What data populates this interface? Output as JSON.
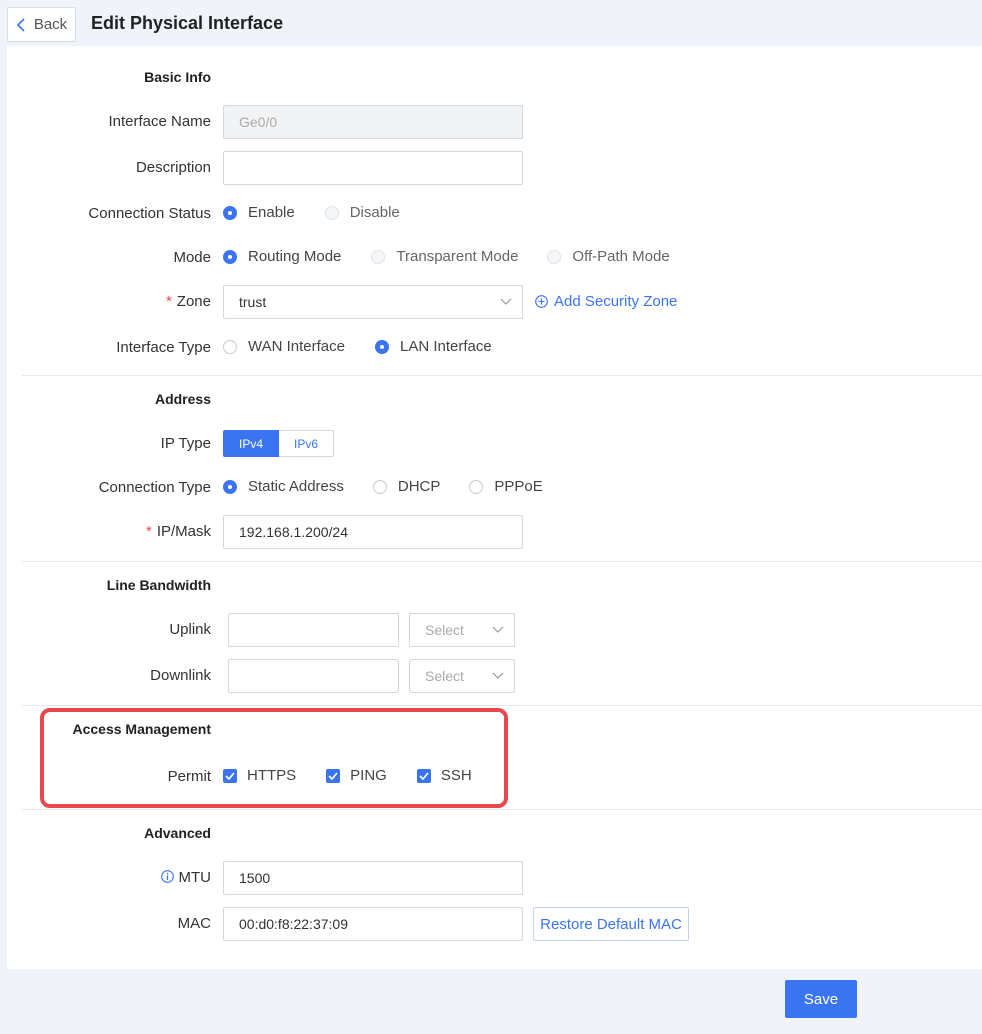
{
  "header": {
    "back_label": "Back",
    "title": "Edit Physical Interface"
  },
  "basic_info": {
    "title": "Basic Info",
    "interface_name": {
      "label": "Interface Name",
      "value": "Ge0/0"
    },
    "description": {
      "label": "Description",
      "value": ""
    },
    "connection_status": {
      "label": "Connection Status",
      "options": [
        "Enable",
        "Disable"
      ],
      "selected": "Enable"
    },
    "mode": {
      "label": "Mode",
      "options": [
        "Routing Mode",
        "Transparent Mode",
        "Off-Path Mode"
      ],
      "selected": "Routing Mode"
    },
    "zone": {
      "required": "*",
      "label": "Zone",
      "value": "trust",
      "add_link": "Add Security Zone"
    },
    "interface_type": {
      "label": "Interface Type",
      "options": [
        "WAN Interface",
        "LAN Interface"
      ],
      "selected": "LAN Interface"
    }
  },
  "address": {
    "title": "Address",
    "ip_type": {
      "label": "IP Type",
      "options": [
        "IPv4",
        "IPv6"
      ],
      "selected": "IPv4"
    },
    "connection_type": {
      "label": "Connection Type",
      "options": [
        "Static Address",
        "DHCP",
        "PPPoE"
      ],
      "selected": "Static Address"
    },
    "ip_mask": {
      "required": "*",
      "label": "IP/Mask",
      "value": "192.168.1.200/24"
    }
  },
  "line_bandwidth": {
    "title": "Line Bandwidth",
    "uplink": {
      "label": "Uplink",
      "value": "",
      "unit_placeholder": "Select"
    },
    "downlink": {
      "label": "Downlink",
      "value": "",
      "unit_placeholder": "Select"
    }
  },
  "access_management": {
    "title": "Access Management",
    "permit": {
      "label": "Permit",
      "options": [
        "HTTPS",
        "PING",
        "SSH"
      ],
      "checked": [
        "HTTPS",
        "PING",
        "SSH"
      ]
    }
  },
  "advanced": {
    "title": "Advanced",
    "mtu": {
      "label": "MTU",
      "value": "1500"
    },
    "mac": {
      "label": "MAC",
      "value": "00:d0:f8:22:37:09",
      "restore_label": "Restore Default MAC"
    }
  },
  "footer": {
    "save_label": "Save"
  },
  "colors": {
    "accent": "#3b74f0",
    "highlight_border": "#e5484d",
    "required": "#f24646"
  }
}
